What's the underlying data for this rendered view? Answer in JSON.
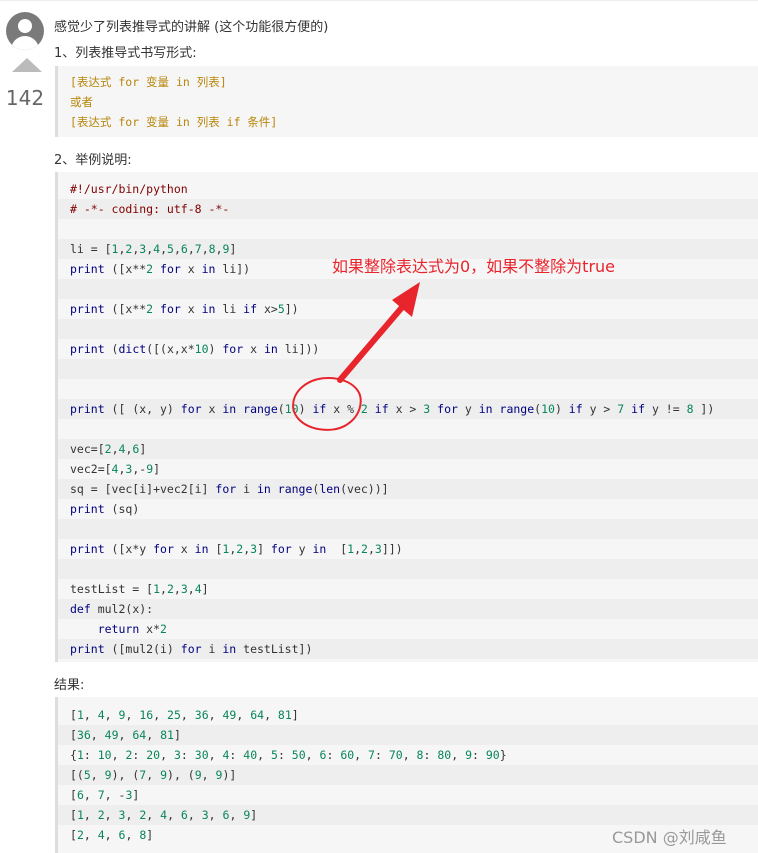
{
  "answer": {
    "votes": "142",
    "title": "感觉少了列表推导式的讲解 (这个功能很方便的)",
    "section1": "1、列表推导式书写形式:",
    "syntax": [
      "[表达式 for 变量 in 列表]",
      "或者",
      "[表达式 for 变量 in 列表 if 条件]"
    ],
    "section2": "2、举例说明:",
    "code": [
      "#!/usr/bin/python",
      "# -*- coding: utf-8 -*-",
      "",
      "li = [1,2,3,4,5,6,7,8,9]",
      "print ([x**2 for x in li])",
      "",
      "print ([x**2 for x in li if x>5])",
      "",
      "print (dict([(x,x*10) for x in li]))",
      "",
      "",
      "print ([ (x, y) for x in range(10) if x % 2 if x > 3 for y in range(10) if y > 7 if y != 8 ])",
      "",
      "vec=[2,4,6]",
      "vec2=[4,3,-9]",
      "sq = [vec[i]+vec2[i] for i in range(len(vec))]",
      "print (sq)",
      "",
      "print ([x*y for x in [1,2,3] for y in  [1,2,3]])",
      "",
      "testList = [1,2,3,4]",
      "def mul2(x):",
      "    return x*2",
      "print ([mul2(i) for i in testList])"
    ],
    "result_label": "结果:",
    "results": [
      "[1, 4, 9, 16, 25, 36, 49, 64, 81]",
      "[36, 49, 64, 81]",
      "{1: 10, 2: 20, 3: 30, 4: 40, 5: 50, 6: 60, 7: 70, 8: 80, 9: 90}",
      "[(5, 9), (7, 9), (9, 9)]",
      "[6, 7, -3]",
      "[1, 2, 3, 2, 4, 6, 3, 6, 9]",
      "[2, 4, 6, 8]"
    ]
  },
  "annotation": "如果整除表达式为0，如果不整除为true",
  "watermark": "CSDN @刘咸鱼",
  "colors": {
    "annotation": "#e8242c",
    "keyword": "#000080",
    "comment": "#800000",
    "number": "#098658"
  }
}
